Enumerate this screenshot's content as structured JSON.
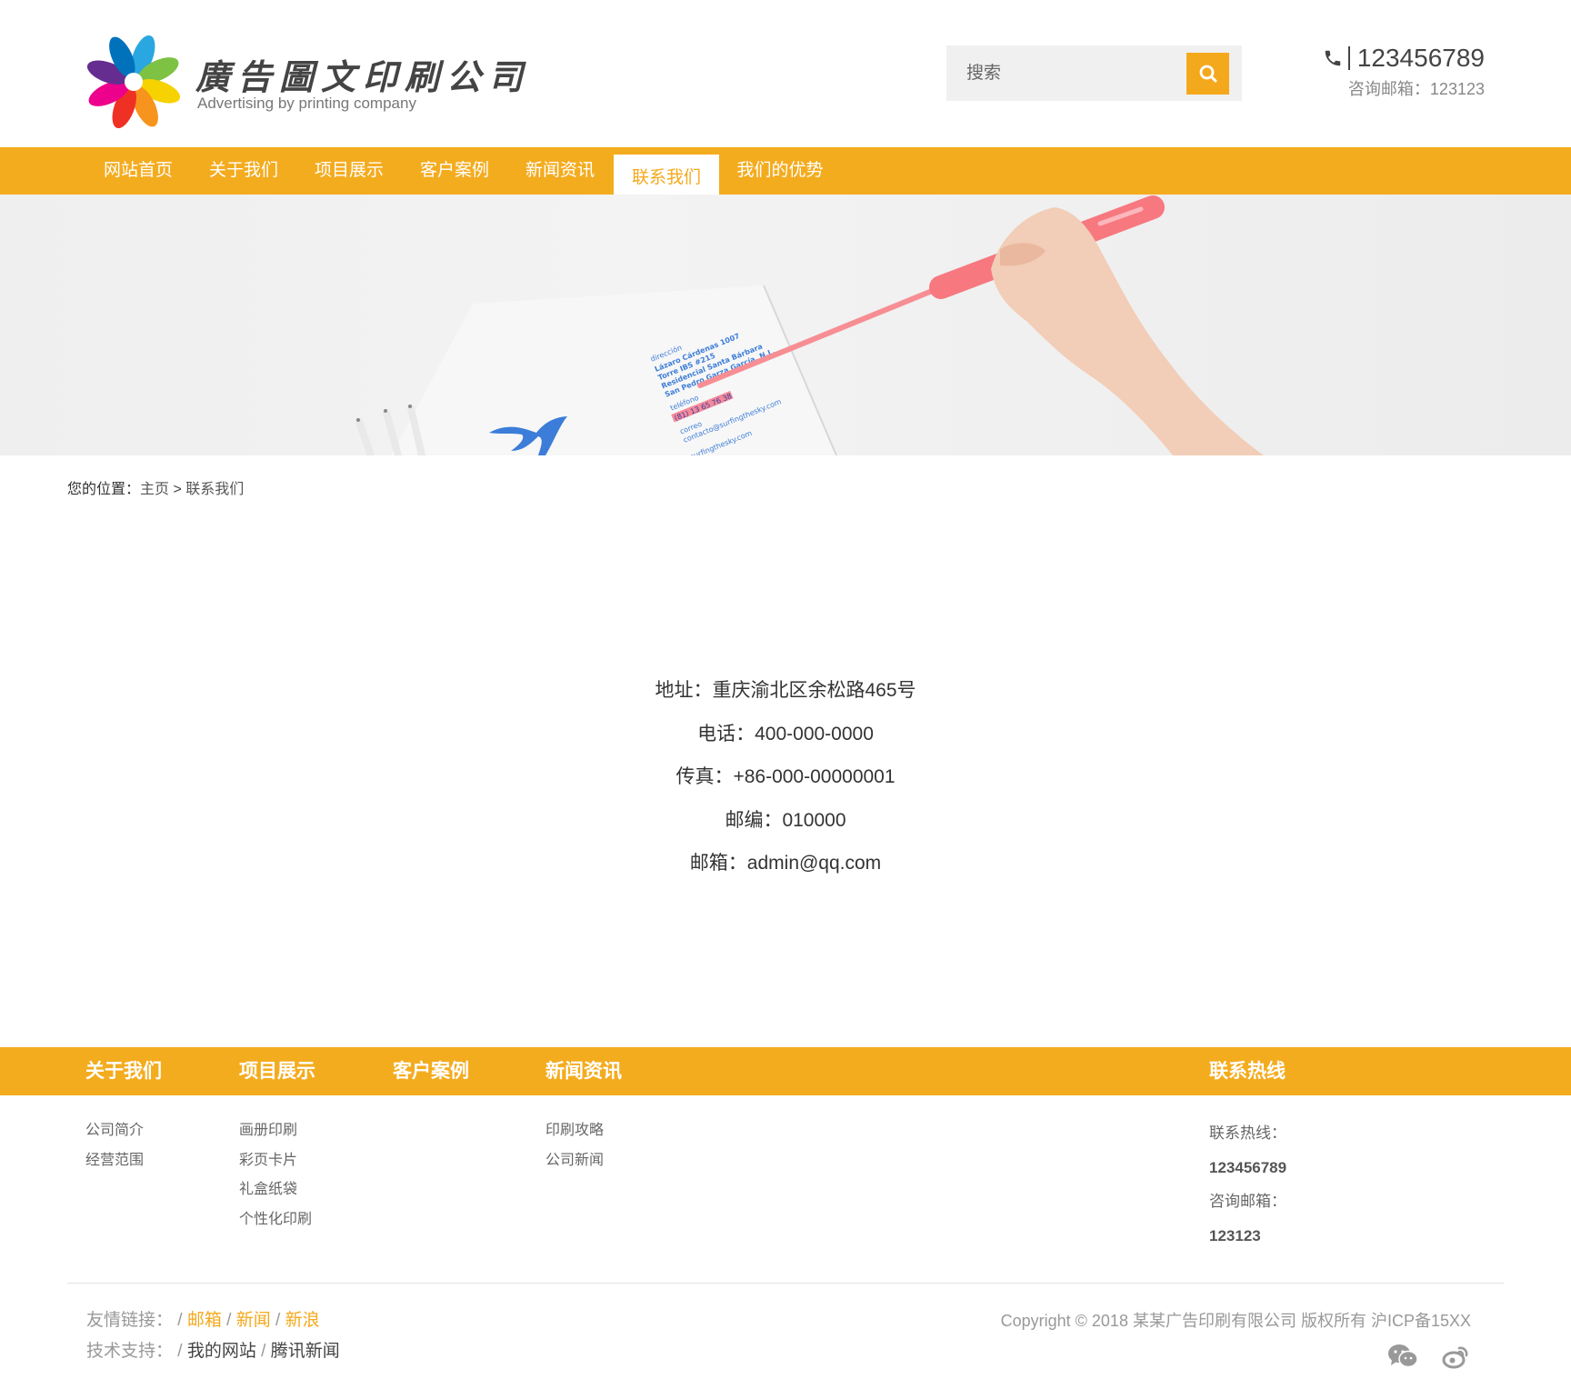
{
  "header": {
    "logo_title": "廣告圖文印刷公司",
    "logo_subtitle": "Advertising by printing company",
    "search_placeholder": "搜索",
    "phone": "123456789",
    "email_line": "咨询邮箱：123123"
  },
  "nav": {
    "items": [
      {
        "label": "网站首页"
      },
      {
        "label": "关于我们"
      },
      {
        "label": "项目展示"
      },
      {
        "label": "客户案例"
      },
      {
        "label": "新闻资讯"
      },
      {
        "label": "联系我们",
        "active": true
      },
      {
        "label": "我们的优势"
      }
    ]
  },
  "breadcrumb": {
    "label": "您的位置：",
    "home": "主页",
    "separator": ">",
    "current": "联系我们"
  },
  "contact": {
    "address": "地址：重庆渝北区余松路465号",
    "phone": "电话：400-000-0000",
    "fax": "传真：+86-000-00000001",
    "zip": "邮编：010000",
    "email": "邮箱：admin@qq.com"
  },
  "footer": {
    "columns": [
      {
        "title": "关于我们",
        "links": [
          "公司简介",
          "经营范围"
        ]
      },
      {
        "title": "项目展示",
        "links": [
          "画册印刷",
          "彩页卡片",
          "礼盒纸袋",
          "个性化印刷"
        ]
      },
      {
        "title": "客户案例",
        "links": []
      },
      {
        "title": "新闻资讯",
        "links": [
          "印刷攻略",
          "公司新闻"
        ]
      }
    ],
    "hotline_title": "联系热线",
    "hotline_label": "联系热线：",
    "hotline_value": "123456789",
    "email_label": "咨询邮箱：",
    "email_value": "123123",
    "friend_links_label": "友情链接：",
    "friend_links": [
      "邮箱",
      "新闻",
      "新浪"
    ],
    "tech_label": "技术支持：",
    "tech_links": [
      "我的网站",
      "腾讯新闻"
    ],
    "copyright": "Copyright © 2018 某某广告印刷有限公司 版权所有   沪ICP备15XX"
  },
  "icons": {
    "search": "search-icon",
    "phone": "phone-icon",
    "wechat": "wechat-icon",
    "weibo": "weibo-icon"
  },
  "colors": {
    "accent": "#f4ac1f",
    "text": "#333333",
    "muted": "#999999"
  }
}
